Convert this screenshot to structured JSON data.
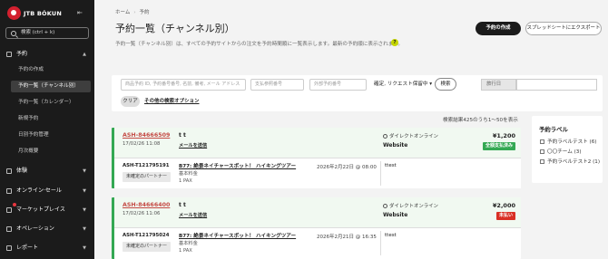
{
  "brand": "JTB BÓKUN",
  "search_placeholder": "検索 (ctrl + k)",
  "nav": {
    "bookings": "予約",
    "sub_items": [
      "予約の作成",
      "予約一覧（チャンネル別）",
      "予約一覧（カレンダー）",
      "新規予約",
      "日別予約管理",
      "月次概要"
    ],
    "experience": "体験",
    "online_sales": "オンライン·セール",
    "marketplace": "マーケットプレイス",
    "operations": "オペレーション",
    "reports": "レポート"
  },
  "breadcrumb": [
    "ホーム",
    "予約"
  ],
  "page_title": "予約一覧（チャンネル別）",
  "page_desc": "予約一覧（チャンネル別）は、すべての予約サイトからの注文を予約時間順に一覧表示します。最新の予約順に表示されます。",
  "help": "?",
  "actions": {
    "create": "予約の作成",
    "export": "スプレッドシートにエクスポート"
  },
  "filters": {
    "product_placeholder": "商品予約 ID, 予約番号番号, 名前, 備考, メール アドレス",
    "payment_placeholder": "支払参照番号",
    "external_placeholder": "外部予約番号",
    "toggle": "確定, リクエスト保留中",
    "search": "検索",
    "travel_date": "旅行日",
    "clear": "クリア",
    "more": "その他の検索オプション"
  },
  "result_count": "検索結果425のうち1～50を表示",
  "cards": [
    {
      "id": "ASH-84666509",
      "date": "17/02/26 11:08",
      "name": "t t",
      "mail": "メールを送信",
      "channel": "ダイレクトオンライン",
      "web": "Website",
      "price": "¥1,200",
      "badge": "全額支払済み",
      "badge_color": "#34a853",
      "rid": "ASH-T121795191",
      "partner": "未確定のパートナー",
      "tour": "B77: 絶景ネイチャースポット！ ハイキングツアー",
      "fee": "基本料金",
      "pax": "1 PAX",
      "rdate": "2026年2月22日 @ 08:00",
      "note": "ttest"
    },
    {
      "id": "ASH-84666400",
      "date": "17/02/26 11:06",
      "name": "t t",
      "mail": "メールを送信",
      "channel": "ダイレクトオンライン",
      "web": "Website",
      "price": "¥2,000",
      "badge": "未払い",
      "badge_color": "#d93025",
      "rid": "ASH-T121795024",
      "partner": "未確定のパートナー",
      "tour": "B77: 絶景ネイチャースポット！ ハイキングツアー",
      "fee": "基本料金",
      "pax": "1 PAX",
      "rdate": "2026年2月21日 @ 16:35",
      "note": "ttest"
    }
  ],
  "labels": {
    "title": "予約ラベル",
    "items": [
      "予約ラベルテスト (6)",
      "〇〇チーム (3)",
      "予約ラベルテスト2 (1)"
    ]
  }
}
